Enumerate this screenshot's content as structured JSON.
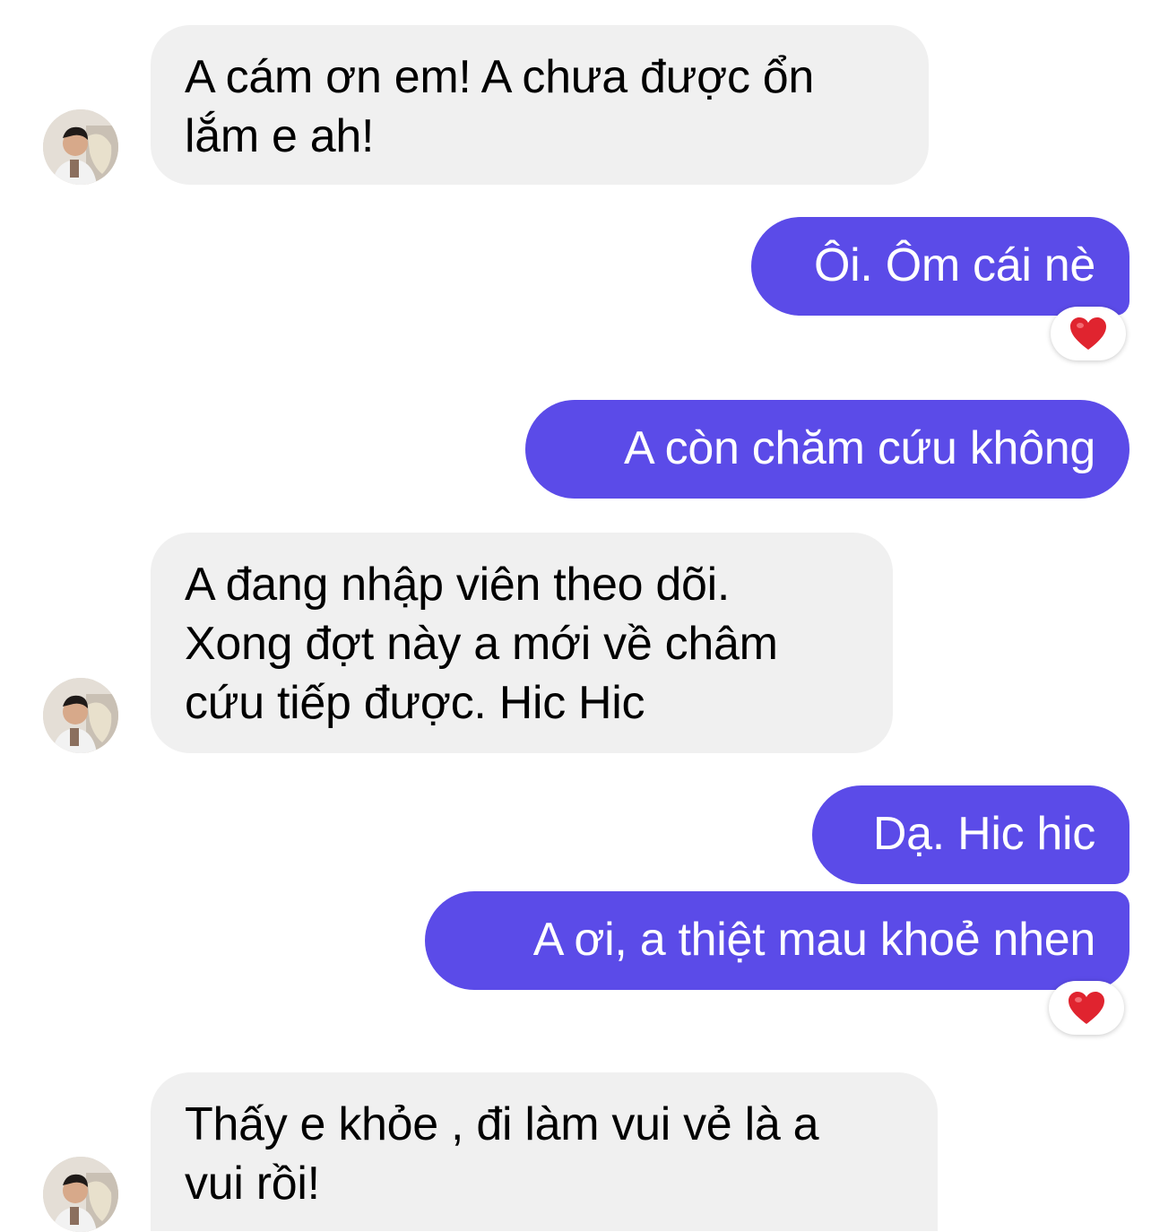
{
  "messages": [
    {
      "side": "incoming",
      "lines": [
        "A cám ơn em! A chưa được ổn",
        "lắm e ah!"
      ]
    },
    {
      "side": "outgoing",
      "lines": [
        "Ôi. Ôm cái nè"
      ],
      "reaction": "heart-icon"
    },
    {
      "side": "outgoing",
      "lines": [
        "A còn chăm cứu không"
      ]
    },
    {
      "side": "incoming",
      "lines": [
        "A đang nhập viên theo dõi.",
        "Xong đợt này a mới về châm",
        "cứu tiếp được. Hic Hic"
      ]
    },
    {
      "side": "outgoing",
      "lines": [
        "Dạ. Hic hic"
      ]
    },
    {
      "side": "outgoing",
      "lines": [
        "A ơi, a thiệt mau khoẻ nhen"
      ],
      "reaction": "heart-icon"
    },
    {
      "side": "incoming",
      "lines": [
        "Thấy e khỏe , đi làm vui vẻ là a",
        "vui rồi!"
      ]
    }
  ],
  "colors": {
    "incoming_bubble": "#f0f0f0",
    "outgoing_bubble": "#5b4be8",
    "outgoing_text": "#ffffff",
    "reaction_heart": "#e0242f"
  }
}
